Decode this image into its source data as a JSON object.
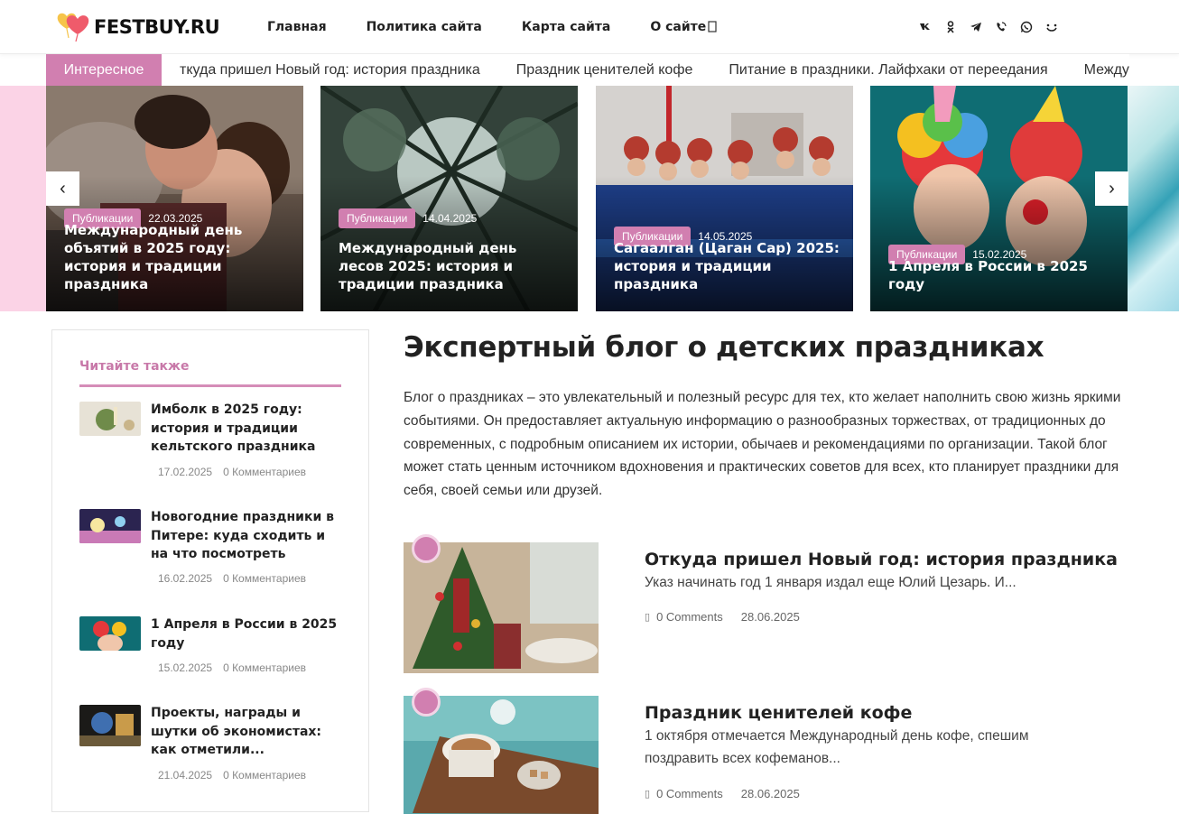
{
  "header": {
    "logo_text": "FESTBUY.RU",
    "nav": [
      "Главная",
      "Политика сайта",
      "Карта сайта",
      "О сайте"
    ],
    "search_glyph": "",
    "socials": [
      "vk-icon",
      "odnoklassniki-icon",
      "telegram-icon",
      "viber-icon",
      "whatsapp-icon",
      "mail-icon"
    ]
  },
  "ticker": {
    "label": "Интересное",
    "items": [
      "ткуда пришел Новый год: история праздника",
      "Праздник ценителей кофе",
      "Питание в праздники. Лайфхаки от переедания",
      "Между"
    ]
  },
  "slider": {
    "prev_label": "‹",
    "next_label": "›",
    "slides": [
      {
        "badge": "Публикации",
        "date": "22.03.2025",
        "title": "Международный день объятий в 2025 году: история и традиции праздника"
      },
      {
        "badge": "Публикации",
        "date": "14.04.2025",
        "title": "Международный день лесов 2025: история и традиции праздника"
      },
      {
        "badge": "Публикации",
        "date": "14.05.2025",
        "title": "Сагаалган (Цаган Сар) 2025: история и традиции праздника"
      },
      {
        "badge": "Публикации",
        "date": "15.02.2025",
        "title": "1 Апреля в России в 2025 году"
      }
    ]
  },
  "sidebar": {
    "title": "Читайте также",
    "items": [
      {
        "title": "Имболк в 2025 году: история и традиции кельтского праздника",
        "date": "17.02.2025",
        "comments": "0 Комментариев"
      },
      {
        "title": "Новогодние праздники в Питере: куда сходить и на что посмотреть",
        "date": "16.02.2025",
        "comments": "0 Комментариев"
      },
      {
        "title": "1 Апреля в России в 2025 году",
        "date": "15.02.2025",
        "comments": "0 Комментариев"
      },
      {
        "title": "Проекты, награды и шутки об экономистах: как отметили...",
        "date": "21.04.2025",
        "comments": "0 Комментариев"
      }
    ]
  },
  "main": {
    "title": "Экспертный блог о детских праздниках",
    "intro": "Блог о праздниках – это увлекательный и полезный ресурс для тех, кто желает наполнить свою жизнь яркими событиями. Он предоставляет актуальную информацию о разнообразных торжествах, от традиционных до современных, с подробным описанием их истории, обычаев и рекомендациями по организации. Такой блог может стать ценным источником вдохновения и практических советов для всех, кто планирует праздники для себя, своей семьи или друзей.",
    "posts": [
      {
        "title": "Откуда пришел Новый год: история праздника",
        "excerpt": "Указ начинать год 1 января издал еще Юлий Цезарь. И...",
        "comments": "0 Comments",
        "date": "28.06.2025",
        "chip": ""
      },
      {
        "title": "Праздник ценителей кофе",
        "excerpt": "1 октября отмечается Международный день кофе, спешим поздравить всех кофеманов...",
        "comments": "0 Comments",
        "date": "28.06.2025",
        "chip": ""
      }
    ]
  },
  "colors": {
    "accent": "#d17fb0",
    "text": "#222222",
    "muted": "#888888"
  }
}
